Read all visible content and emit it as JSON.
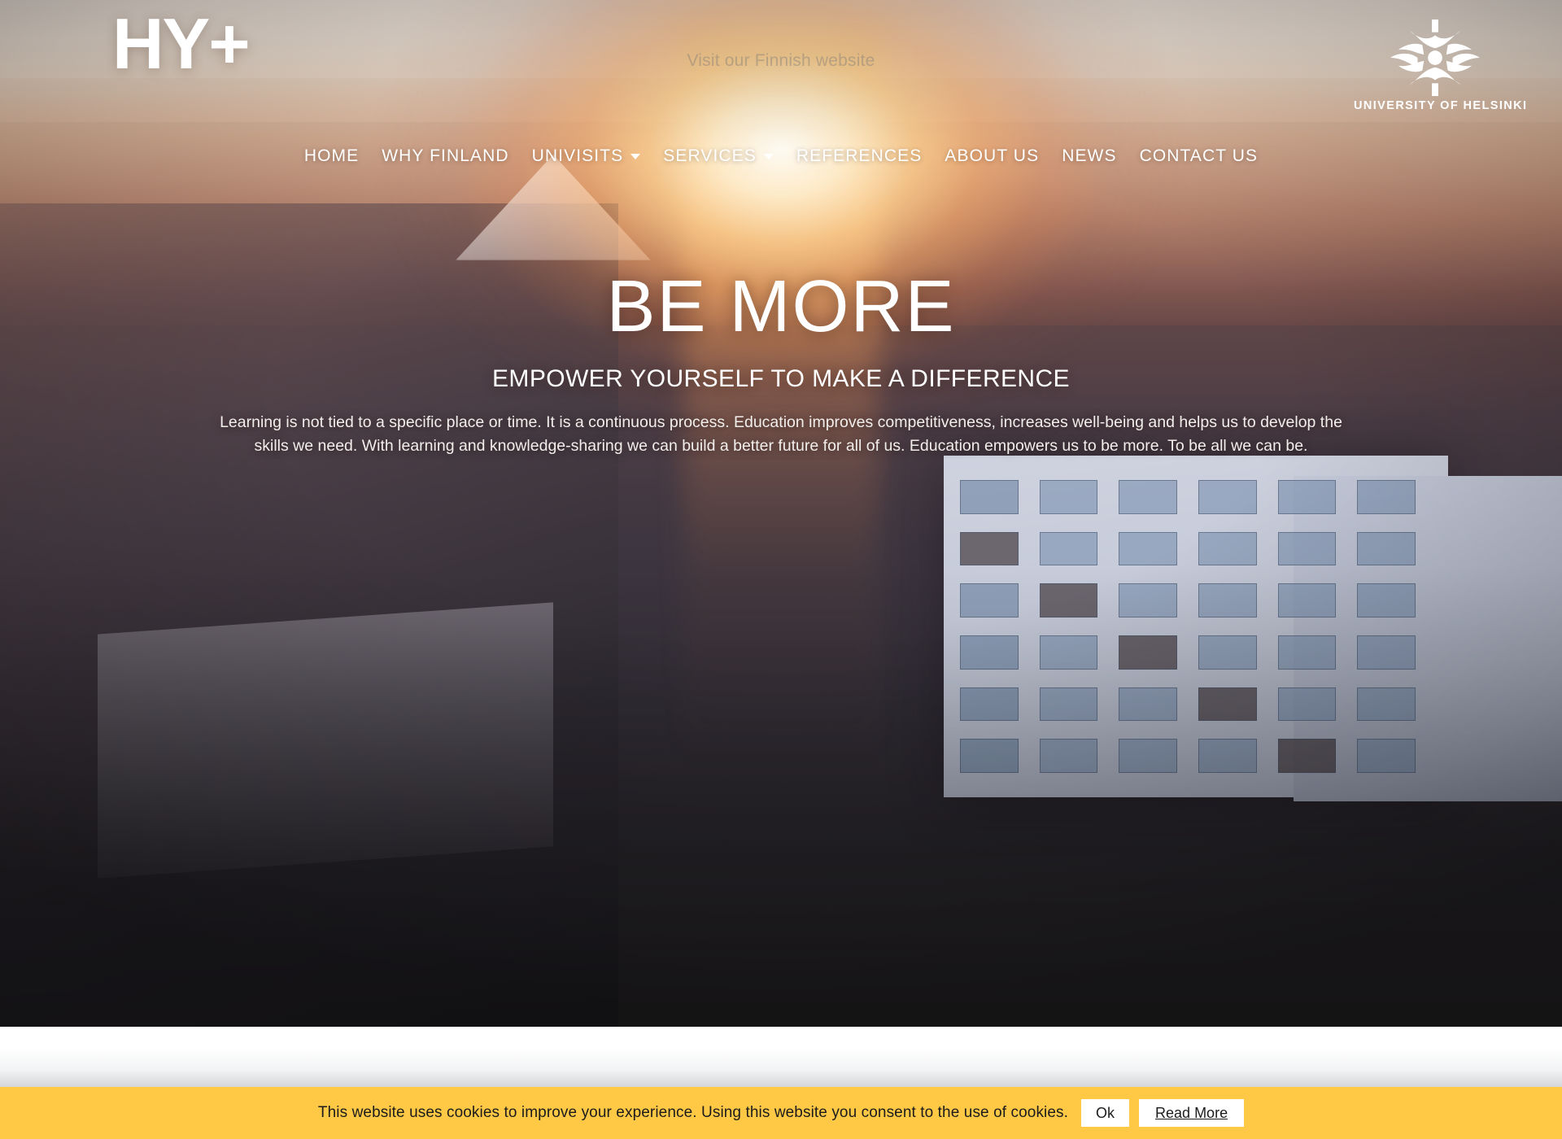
{
  "header": {
    "logo_text": "HY+",
    "language_link": "Visit our Finnish website",
    "partner_logo": {
      "icon": "university-of-helsinki-sun-emblem",
      "name": "UNIVERSITY OF HELSINKI"
    },
    "nav": [
      {
        "label": "HOME",
        "has_dropdown": false,
        "icon": ""
      },
      {
        "label": "WHY FINLAND",
        "has_dropdown": false,
        "icon": ""
      },
      {
        "label": "UNIVISITS",
        "has_dropdown": true,
        "icon": "chevron-down-icon"
      },
      {
        "label": "SERVICES",
        "has_dropdown": true,
        "icon": "chevron-down-icon"
      },
      {
        "label": "REFERENCES",
        "has_dropdown": false,
        "icon": ""
      },
      {
        "label": "ABOUT US",
        "has_dropdown": false,
        "icon": ""
      },
      {
        "label": "NEWS",
        "has_dropdown": false,
        "icon": ""
      },
      {
        "label": "CONTACT US",
        "has_dropdown": false,
        "icon": ""
      }
    ]
  },
  "hero": {
    "title": "BE MORE",
    "subtitle": "EMPOWER YOURSELF TO MAKE A DIFFERENCE",
    "body": "Learning is not tied to a specific place or time. It is a continuous process. Education improves competitiveness, increases well-being and helps us to develop the skills we need. With learning and knowledge-sharing we can build a better future for all of us. Education empowers us to be more. To be all we can be."
  },
  "cookie_banner": {
    "message": "This website uses cookies to improve your experience. Using this website you consent to the use of cookies.",
    "accept_label": "Ok",
    "read_more_label": "Read More",
    "background_color": "#ffc845",
    "text_color": "#1c1c1c"
  },
  "colors": {
    "banner_amber": "#ffc845",
    "hero_sun_glow": "#ffcf8c",
    "nav_text": "#ffffff",
    "page_background": "#ffffff"
  }
}
